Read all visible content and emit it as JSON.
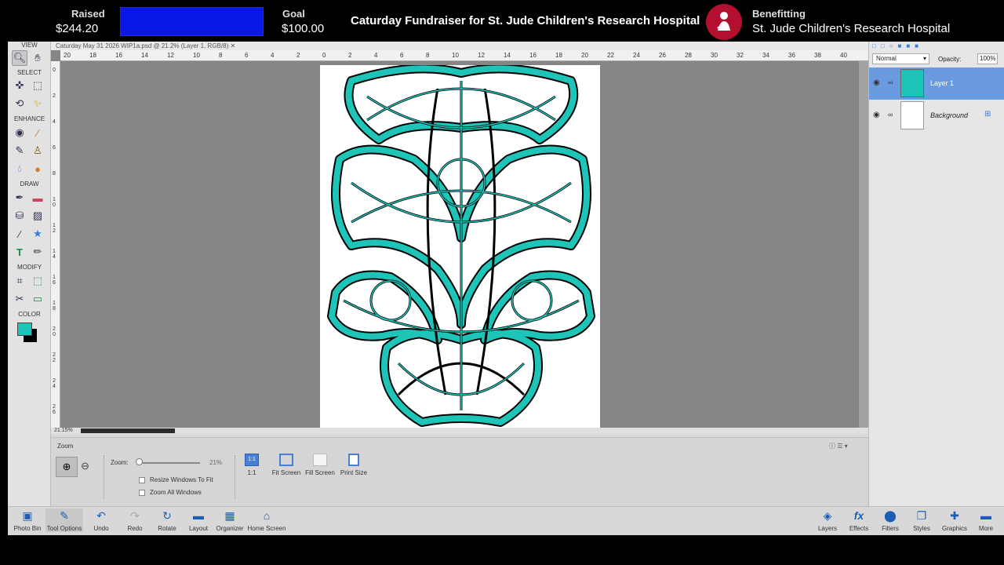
{
  "fundraiser": {
    "raised_label": "Raised",
    "raised_value": "$244.20",
    "goal_label": "Goal",
    "goal_value": "$100.00",
    "campaign_title": "Caturday Fundraiser for St. Jude Children's Research Hospital",
    "benefitting_label": "Benefitting",
    "beneficiary": "St. Jude Children's Research Hospital",
    "progress_fraction": 1.0
  },
  "document": {
    "tab_title": "Caturday May 31 2026 WIP1a.psd @ 21.2% (Layer 1, RGB/8)",
    "status_zoom": "21.15%",
    "ruler_h": [
      "20",
      "18",
      "16",
      "14",
      "12",
      "10",
      "8",
      "6",
      "4",
      "2",
      "0",
      "2",
      "4",
      "6",
      "8",
      "10",
      "12",
      "14",
      "16",
      "18",
      "20",
      "22",
      "24",
      "26",
      "28",
      "30",
      "32",
      "34",
      "36",
      "38",
      "40"
    ],
    "ruler_v": [
      "0",
      "2",
      "4",
      "6",
      "8",
      "1 0",
      "1 2",
      "1 4",
      "1 6",
      "1 8",
      "2 0",
      "2 2",
      "2 4",
      "2 6",
      "2 8"
    ]
  },
  "toolbox": {
    "sections": [
      "VIEW",
      "SELECT",
      "ENHANCE",
      "DRAW",
      "MODIFY",
      "COLOR"
    ],
    "foreground_color": "#1fc4b8",
    "background_color": "#000000"
  },
  "tool_options": {
    "title": "Zoom",
    "zoom_label": "Zoom:",
    "zoom_value": "21%",
    "zoom_slider_fraction": 0.0,
    "resize_windows": "Resize Windows To Fit",
    "zoom_all": "Zoom All Windows",
    "buttons": [
      "1:1",
      "Fit Screen",
      "Fill Screen",
      "Print Size"
    ]
  },
  "layers_panel": {
    "blend_mode": "Normal",
    "opacity_label": "Opacity:",
    "opacity_value": "100%",
    "layers": [
      "Layer 1",
      "Background"
    ]
  },
  "taskbar_left": [
    "Photo Bin",
    "Tool Options",
    "Undo",
    "Redo",
    "Rotate",
    "Layout",
    "Organizer",
    "Home Screen"
  ],
  "taskbar_right": [
    "Layers",
    "Effects",
    "Filters",
    "Styles",
    "Graphics",
    "More"
  ],
  "colors": {
    "selection_blue": "#6a9be0",
    "knot_teal": "#1fc4b8"
  }
}
